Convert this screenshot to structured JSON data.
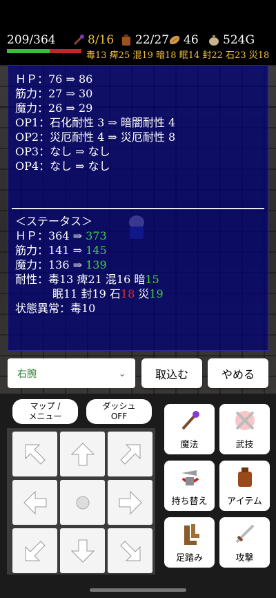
{
  "status": {
    "hp_text": "209/364",
    "hp_fraction": 0.574,
    "weapon_count": "8/16",
    "bag_count": "22/27",
    "food_count": "46",
    "gold": "524G",
    "resists": "毒13 痺25 混19 暗18 眠14 封22 石23 災18"
  },
  "window": {
    "before": [
      "ＨＰ：76 ⇒ 86",
      "筋力：27 ⇒ 30",
      "魔力：26 ⇒ 29",
      "OP1：石化耐性 3 ⇒ 暗闇耐性 4",
      "OP2：災厄耐性 4 ⇒ 災厄耐性 8",
      "OP3：なし ⇒ なし",
      "OP4：なし ⇒ なし"
    ],
    "status_header": "＜ステータス＞",
    "hp_label": "ＨＰ：364 ⇒ ",
    "hp_new": "373",
    "str_label": "筋力：141 ⇒ ",
    "str_new": "145",
    "mag_label": "魔力：136 ⇒ ",
    "mag_new": "139",
    "res1_a": "耐性：毒13 痺21 混16 暗",
    "res1_b": "15",
    "res2_a": "眠11 封19 石",
    "res2_b": "18",
    "res2_c": " 災",
    "res2_d": "19",
    "ailment": "状態異常：毒10"
  },
  "controls": {
    "slot_select": "右腕",
    "confirm": "取込む",
    "cancel": "やめる"
  },
  "bottom": {
    "map_menu_1": "マップ /",
    "map_menu_2": "メニュー",
    "dash_1": "ダッシュ",
    "dash_2": "OFF",
    "magic": "魔法",
    "skill": "武技",
    "swap": "持ち替え",
    "item": "アイテム",
    "step": "足踏み",
    "attack": "攻撃"
  },
  "icons": [
    "wand-icon",
    "bag-icon",
    "bread-icon",
    "coin-bag-icon",
    "sword-icon",
    "arrow-icons"
  ],
  "colors": {
    "gold": "#f0c03a",
    "increase": "#3ed23e",
    "decrease": "#e03030",
    "hp_green": "#35c23a",
    "hp_red": "#c0262b"
  }
}
